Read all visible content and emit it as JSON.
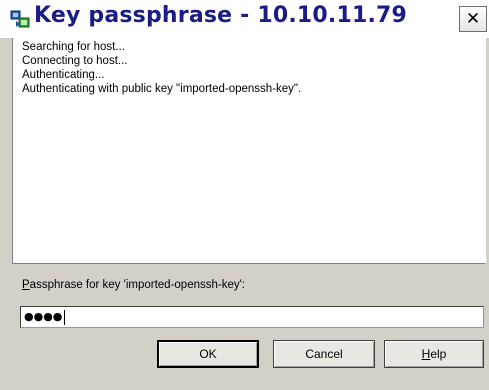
{
  "window": {
    "title": "Key passphrase - 10.10.11.79",
    "close_icon": "close-icon",
    "app_icon": "putty-icon"
  },
  "log": {
    "lines": [
      "Searching for host...",
      "Connecting to host...",
      "Authenticating...",
      "Authenticating with public key \"imported-openssh-key\"."
    ]
  },
  "prompt": {
    "label_mnemonic": "P",
    "label_rest": "assphrase for key 'imported-openssh-key':",
    "masked_value": "●●●●"
  },
  "buttons": {
    "ok": "OK",
    "cancel": "Cancel",
    "help_mnemonic": "H",
    "help_rest": "elp"
  }
}
